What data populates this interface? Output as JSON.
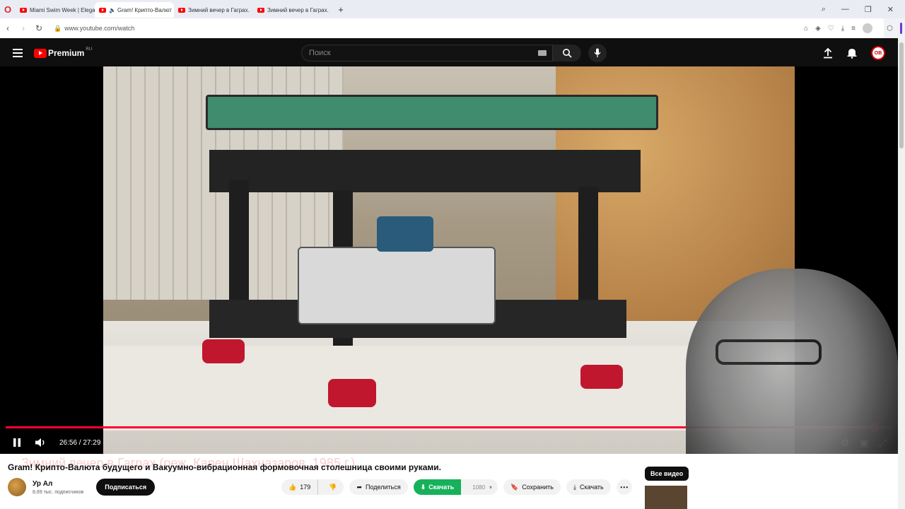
{
  "browser": {
    "tabs": [
      {
        "label": "Miami Swim Week | Elega"
      },
      {
        "label": "Gram! Крипто-Валют"
      },
      {
        "label": "Зимний вечер в Гаграх."
      },
      {
        "label": "Зимний вечер в Гаграх."
      }
    ],
    "url": "www.youtube.com/watch"
  },
  "header": {
    "logo_text": "Premium",
    "logo_region": "RU",
    "search_placeholder": "Поиск",
    "avatar_initials": "OB"
  },
  "player": {
    "time_current": "26:56",
    "time_total": "27:29",
    "time_display": "26:56 / 27:29",
    "progress": 0.98,
    "accent": "#ff0033"
  },
  "video": {
    "title": "Gram! Крипто-Валюта будущего и Вакуумно-вибрационная формовочная столешница своими руками.",
    "overlay_ghost": "Зимний вечер в Гаграх (реж. Карен Шахназаров, 1985 г.)",
    "channel_name": "Ур Ал",
    "subscribers": "8,69 тыс. подписчиков",
    "subscribe_label": "Подписаться",
    "likes": "179",
    "share_label": "Поделиться",
    "download_green_label": "Скачать",
    "download_quality": "1080",
    "save_label": "Сохранить",
    "download_label": "Скачать"
  },
  "sidebar": {
    "all_videos_label": "Все видео"
  }
}
